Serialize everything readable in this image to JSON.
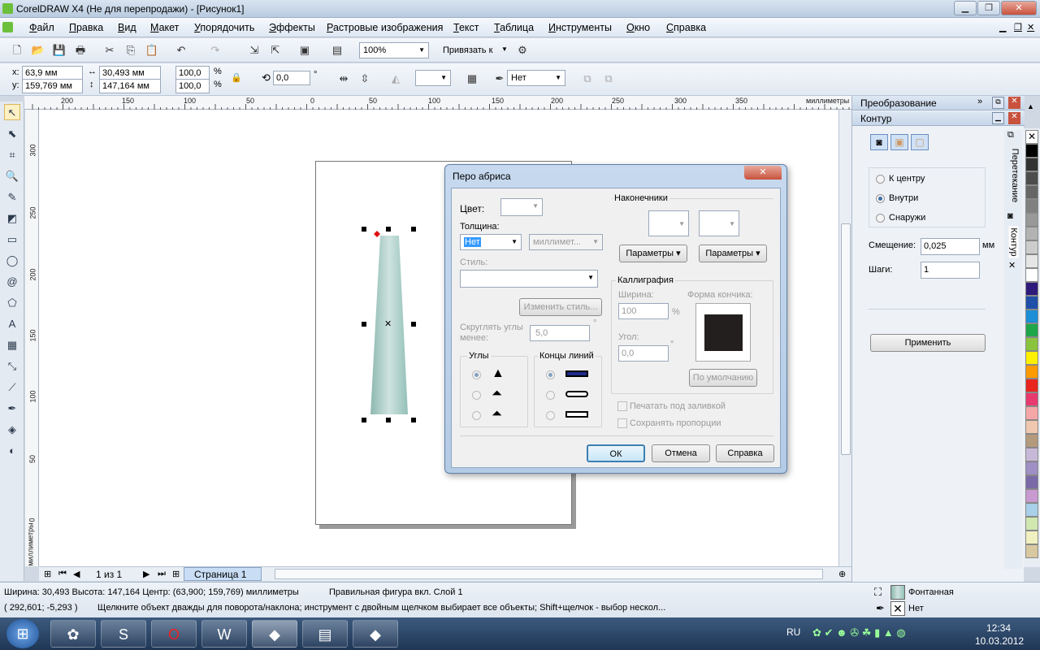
{
  "window": {
    "title": "CorelDRAW X4 (Не для перепродажи) - [Рисунок1]"
  },
  "menu": [
    "Файл",
    "Правка",
    "Вид",
    "Макет",
    "Упорядочить",
    "Эффекты",
    "Растровые изображения",
    "Текст",
    "Таблица",
    "Инструменты",
    "Окно",
    "Справка"
  ],
  "toolbar": {
    "zoom": "100%",
    "snap_label": "Привязать к"
  },
  "props": {
    "x_label": "x:",
    "x": "63,9 мм",
    "y_label": "y:",
    "y": "159,769 мм",
    "w": "30,493 мм",
    "h": "147,164 мм",
    "scale_w": "100,0",
    "scale_h": "100,0",
    "pct": "%",
    "rotation": "0,0",
    "deg": "°",
    "outline": "Нет"
  },
  "ruler": {
    "top_ticks": [
      "200",
      "150",
      "100",
      "50",
      "0",
      "50",
      "100",
      "150",
      "200",
      "250",
      "300",
      "350"
    ],
    "units": "миллиметры",
    "left_ticks": [
      "300",
      "250",
      "200",
      "150",
      "100",
      "50",
      "0"
    ],
    "left_units": "миллиметры"
  },
  "page_nav": {
    "pages": "1 из 1",
    "tab": "Страница 1"
  },
  "docker": {
    "header1": "Преобразование",
    "header2": "Контур",
    "options": [
      "К центру",
      "Внутри",
      "Снаружи"
    ],
    "selected_option": "Внутри",
    "offset_label": "Смещение:",
    "offset": "0,025",
    "offset_unit": "мм",
    "steps_label": "Шаги:",
    "steps": "1",
    "apply": "Применить",
    "side_tabs": [
      "Перетекание",
      "Контур"
    ]
  },
  "palette": {
    "colors": [
      "#ffffff",
      "#000000",
      "#333333",
      "#4d4d4d",
      "#666666",
      "#808080",
      "#999999",
      "#b3b3b3",
      "#cccccc",
      "#e6e6e6",
      "#ffffff",
      "#2e1a7a",
      "#1f4fa8",
      "#1c8fd6",
      "#1fa64a",
      "#8ac43f",
      "#ffef00",
      "#ff9a00",
      "#e8251f",
      "#e83a6e",
      "#f5a6a6",
      "#f0c8b0",
      "#b49a7d",
      "#c8b8d8",
      "#9e8fc4",
      "#7a6aa8",
      "#c89ad0",
      "#a8d0e8",
      "#d0e8b0",
      "#f0f0c0",
      "#d8c8a0"
    ]
  },
  "dialog": {
    "title": "Перо абриса",
    "color_label": "Цвет:",
    "thickness_label": "Толщина:",
    "thickness": "Нет",
    "units": "миллимет...",
    "style_label": "Стиль:",
    "edit_style": "Изменить стиль...",
    "round_label": "Скруглять углы менее:",
    "round_value": "5,0",
    "corners_label": "Углы",
    "linecaps_label": "Концы линий",
    "arrows_label": "Наконечники",
    "params1": "Параметры",
    "params2": "Параметры",
    "calligraphy_label": "Каллиграфия",
    "width_label": "Ширина:",
    "width_value": "100",
    "angle_label": "Угол:",
    "angle_value": "0,0",
    "nib_label": "Форма кончика:",
    "default_btn": "По умолчанию",
    "print_under_fill": "Печатать под заливкой",
    "scale_with_image": "Сохранять пропорции",
    "ok": "ОК",
    "cancel": "Отмена",
    "help": "Справка"
  },
  "status": {
    "line1": "Ширина: 30,493  Высота: 147,164  Центр: (63,900; 159,769)  миллиметры",
    "layer": "Правильная фигура вкл. Слой 1",
    "coords": "( 292,601; -5,293 )",
    "hint": "Щелкните объект дважды для поворота/наклона; инструмент с двойным щелчком выбирает все объекты; Shift+щелчок - выбор нескол...",
    "fill": "Фонтанная",
    "outline": "Нет"
  },
  "tray": {
    "lang": "RU",
    "time": "12:34",
    "date": "10.03.2012"
  }
}
